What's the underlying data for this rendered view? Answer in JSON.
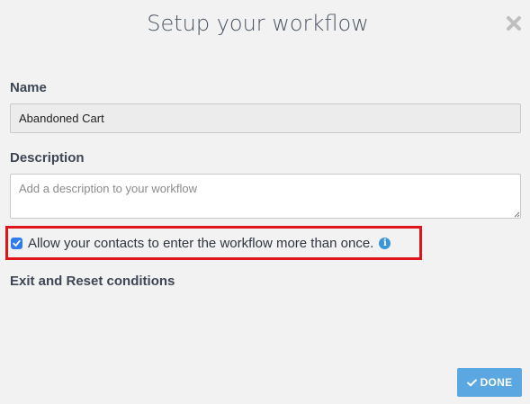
{
  "dialog": {
    "title": "Setup your workflow"
  },
  "form": {
    "name_label": "Name",
    "name_value": "Abandoned Cart",
    "description_label": "Description",
    "description_placeholder": "Add a description to your workflow",
    "description_value": "",
    "allow_reentry_label": "Allow your contacts to enter the workflow more than once.",
    "allow_reentry_checked": true,
    "exit_reset_label": "Exit and Reset conditions"
  },
  "actions": {
    "done_label": "DONE"
  },
  "icons": {
    "close": "close-icon",
    "info": "info-icon",
    "check": "check-icon"
  },
  "colors": {
    "highlight": "#e0151b",
    "primary_button": "#5aa7e1",
    "checkbox": "#2f7cf0",
    "info": "#3b95d9"
  }
}
